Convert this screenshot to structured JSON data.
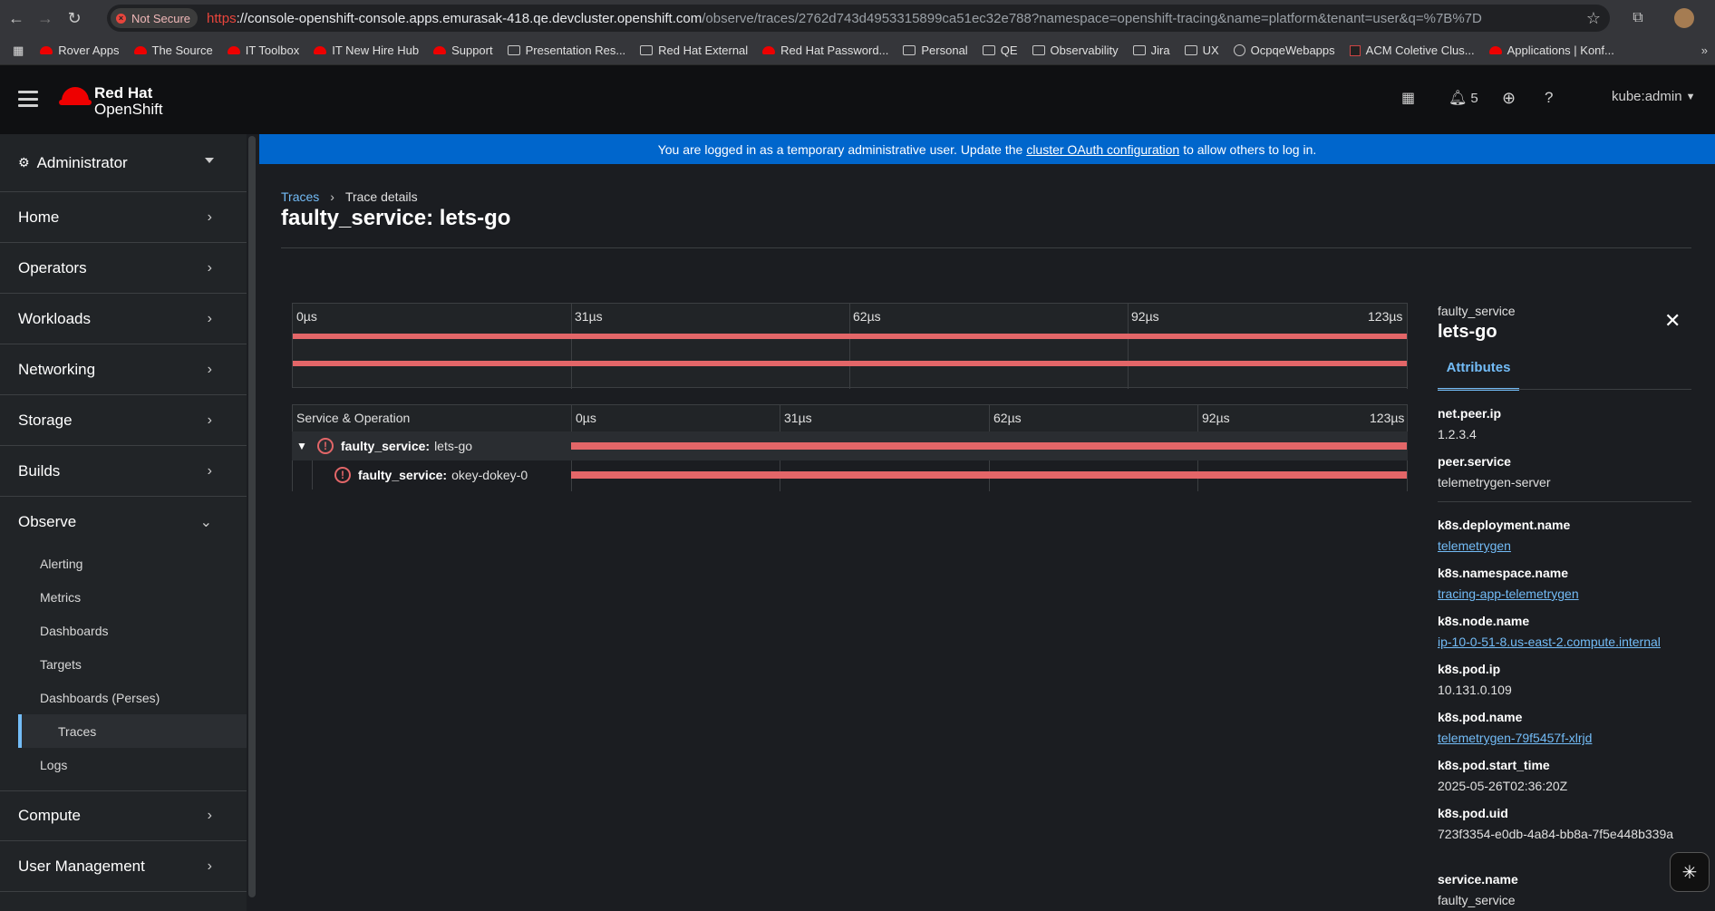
{
  "browser": {
    "not_secure": "Not Secure",
    "url_scheme": "https",
    "url_host": "://console-openshift-console.apps.emurasak-418.qe.devcluster.openshift.com",
    "url_path": "/observe/traces/2762d743d4953315899ca51ec32e788?namespace=openshift-tracing&name=platform&tenant=user&q=%7B%7D",
    "bookmarks": [
      {
        "label": "Rover Apps",
        "icon": "redhat-icon"
      },
      {
        "label": "The Source",
        "icon": "redhat-icon"
      },
      {
        "label": "IT Toolbox",
        "icon": "redhat-icon"
      },
      {
        "label": "IT New Hire Hub",
        "icon": "redhat-icon"
      },
      {
        "label": "Support",
        "icon": "redhat-icon"
      },
      {
        "label": "Presentation Res...",
        "icon": "folder-icon"
      },
      {
        "label": "Red Hat External",
        "icon": "folder-icon"
      },
      {
        "label": "Red Hat Password...",
        "icon": "redhat-icon"
      },
      {
        "label": "Personal",
        "icon": "folder-icon"
      },
      {
        "label": "QE",
        "icon": "folder-icon"
      },
      {
        "label": "Observability",
        "icon": "folder-icon"
      },
      {
        "label": "Jira",
        "icon": "folder-icon"
      },
      {
        "label": "UX",
        "icon": "folder-icon"
      },
      {
        "label": "OcpqeWebapps",
        "icon": "globe-icon"
      },
      {
        "label": "ACM Coletive Clus...",
        "icon": "acm-icon"
      },
      {
        "label": "Applications | Konf...",
        "icon": "redhat-icon"
      }
    ]
  },
  "masthead": {
    "brand_line1": "Red Hat",
    "brand_line2": "OpenShift",
    "notifications_count": "5",
    "user": "kube:admin"
  },
  "banner": {
    "text_before": "You are logged in as a temporary administrative user. Update the",
    "link": "cluster OAuth configuration",
    "text_after": "to allow others to log in."
  },
  "sidebar": {
    "perspective": "Administrator",
    "groups": [
      "Home",
      "Operators",
      "Workloads",
      "Networking",
      "Storage",
      "Builds",
      "Observe"
    ],
    "observe_items": [
      "Alerting",
      "Metrics",
      "Dashboards",
      "Targets",
      "Dashboards (Perses)",
      "Traces",
      "Logs"
    ],
    "lower_groups": [
      "Compute",
      "User Management"
    ]
  },
  "page": {
    "breadcrumb_link": "Traces",
    "breadcrumb_current": "Trace details",
    "title": "faulty_service: lets-go"
  },
  "minimap": {
    "ticks": [
      "0µs",
      "31µs",
      "62µs",
      "92µs",
      "123µs"
    ]
  },
  "timeline": {
    "header": "Service & Operation",
    "ticks": [
      "0µs",
      "31µs",
      "62µs",
      "92µs",
      "123µs"
    ],
    "spans": [
      {
        "service": "faulty_service:",
        "operation": "lets-go"
      },
      {
        "service": "faulty_service:",
        "operation": "okey-dokey-0"
      }
    ]
  },
  "details": {
    "service": "faulty_service",
    "operation": "lets-go",
    "tab": "Attributes",
    "attrs": [
      {
        "k": "net.peer.ip",
        "v": "1.2.3.4"
      },
      {
        "k": "peer.service",
        "v": "telemetrygen-server"
      },
      {
        "k": "k8s.deployment.name",
        "v": "telemetrygen"
      },
      {
        "k": "k8s.namespace.name",
        "v": "tracing-app-telemetrygen"
      },
      {
        "k": "k8s.node.name",
        "v": "ip-10-0-51-8.us-east-2.compute.internal"
      },
      {
        "k": "k8s.pod.ip",
        "v": "10.131.0.109"
      },
      {
        "k": "k8s.pod.name",
        "v": "telemetrygen-79f5457f-xlrjd"
      },
      {
        "k": "k8s.pod.start_time",
        "v": "2025-05-26T02:36:20Z"
      },
      {
        "k": "k8s.pod.uid",
        "v": "723f3354-e0db-4a84-bb8a-7f5e448b339a"
      },
      {
        "k": "service.name",
        "v": "faulty_service"
      }
    ]
  }
}
